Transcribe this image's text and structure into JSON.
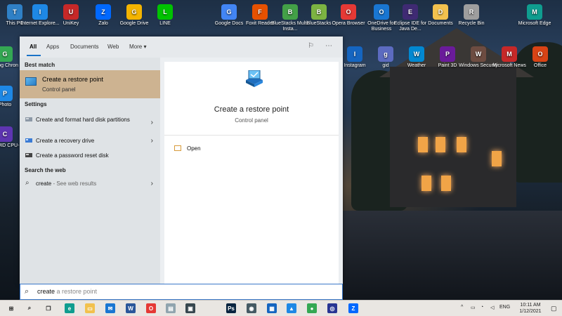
{
  "desktop": {
    "icons_top": [
      {
        "label": "This PC",
        "icon": "this-pc-icon",
        "color": "#2f80c6"
      },
      {
        "label": "Internet Explore...",
        "icon": "internet-explorer-icon",
        "color": "#1e88e5"
      },
      {
        "label": "UniKey",
        "icon": "unikey-icon",
        "color": "#c62828"
      },
      {
        "label": "Zalo",
        "icon": "zalo-icon",
        "color": "#0068ff"
      },
      {
        "label": "Google Drive",
        "icon": "google-drive-icon",
        "color": "#f4b400"
      },
      {
        "label": "LINE",
        "icon": "line-icon",
        "color": "#00c300"
      },
      {
        "label": "Google Docs",
        "icon": "google-docs-icon",
        "color": "#4285f4"
      },
      {
        "label": "Foxit Reader",
        "icon": "foxit-reader-icon",
        "color": "#e65100"
      },
      {
        "label": "BlueStacks Multi-Insta...",
        "icon": "bluestacks-multi-icon",
        "color": "#43a047"
      },
      {
        "label": "BlueStacks",
        "icon": "bluestacks-icon",
        "color": "#7cb342"
      },
      {
        "label": "Opera Browser",
        "icon": "opera-icon",
        "color": "#e53935"
      },
      {
        "label": "OneDrive for Business",
        "icon": "onedrive-icon",
        "color": "#1976d2"
      },
      {
        "label": "Eclipse IDE for Java De...",
        "icon": "eclipse-icon",
        "color": "#3f2a73"
      },
      {
        "label": "Documents",
        "icon": "documents-folder-icon",
        "color": "#f2c14e"
      },
      {
        "label": "Recycle Bin",
        "icon": "recycle-bin-icon",
        "color": "#9e9e9e"
      },
      {
        "label": "Microsoft Edge",
        "icon": "microsoft-edge-icon",
        "color": "#0f9d8f"
      }
    ],
    "icons_row2": [
      {
        "label": "Instagram",
        "icon": "instagram-icon",
        "color": "#1565c0"
      },
      {
        "label": "gid",
        "icon": "clock-app-icon",
        "color": "#5c6bc0"
      },
      {
        "label": "Weather",
        "icon": "weather-icon",
        "color": "#0288d1"
      },
      {
        "label": "Paint 3D",
        "icon": "paint-3d-icon",
        "color": "#6a1b9a"
      },
      {
        "label": "Windows Security",
        "icon": "windows-security-icon",
        "color": "#6d4c41"
      },
      {
        "label": "Microsoft News",
        "icon": "microsoft-news-icon",
        "color": "#c62828"
      },
      {
        "label": "Office",
        "icon": "office-icon",
        "color": "#d84315"
      }
    ],
    "icons_left": [
      {
        "label": "Goog Chron",
        "icon": "chrome-icon",
        "color": "#34a853"
      },
      {
        "label": "Photo",
        "icon": "photos-icon",
        "color": "#1e88e5"
      },
      {
        "label": "CPUID CPU-",
        "icon": "cpuid-icon",
        "color": "#5e35b1"
      }
    ]
  },
  "search": {
    "tabs": [
      "All",
      "Apps",
      "Documents",
      "Web",
      "More ▾"
    ],
    "feedback_icon": "feedback-icon",
    "more_options_icon": "more-options-icon",
    "best_match_heading": "Best match",
    "best_match": {
      "title": "Create a restore point",
      "subtitle": "Control panel"
    },
    "settings_heading": "Settings",
    "settings": [
      {
        "label": "Create and format hard disk partitions"
      },
      {
        "label": "Create a recovery drive"
      },
      {
        "label": "Create a password reset disk"
      }
    ],
    "web_heading": "Search the web",
    "web_result": {
      "query": "create",
      "suffix": " - See web results"
    },
    "preview": {
      "title": "Create a restore point",
      "subtitle": "Control panel",
      "action": "Open"
    },
    "query_typed": "create",
    "query_ghost": " a restore point"
  },
  "taskbar": {
    "apps": [
      {
        "icon": "windows-start-icon",
        "color": "#222222",
        "glyph": "⊞"
      },
      {
        "icon": "search-icon",
        "color": "#222222",
        "glyph": "⌕"
      },
      {
        "icon": "task-view-icon",
        "color": "#222222",
        "glyph": "❐"
      },
      {
        "icon": "edge-taskbar-icon",
        "color": "#0f9d8f",
        "glyph": "e"
      },
      {
        "icon": "file-explorer-icon",
        "color": "#f2c14e",
        "glyph": "▭"
      },
      {
        "icon": "mail-icon",
        "color": "#1976d2",
        "glyph": "✉"
      },
      {
        "icon": "word-icon",
        "color": "#2b579a",
        "glyph": "W"
      },
      {
        "icon": "opera-taskbar-icon",
        "color": "#e53935",
        "glyph": "O"
      },
      {
        "icon": "notepad-icon",
        "color": "#90a4ae",
        "glyph": "▤"
      },
      {
        "icon": "store-icon",
        "color": "#37474f",
        "glyph": "▣"
      },
      {
        "icon": "photoshop-icon",
        "color": "#0a2540",
        "glyph": "Ps"
      },
      {
        "icon": "camera-icon",
        "color": "#455a64",
        "glyph": "◉"
      },
      {
        "icon": "virtualbox-icon",
        "color": "#1565c0",
        "glyph": "▦"
      },
      {
        "icon": "photos-taskbar-icon",
        "color": "#1e88e5",
        "glyph": "▲"
      },
      {
        "icon": "chrome-taskbar-icon",
        "color": "#34a853",
        "glyph": "●"
      },
      {
        "icon": "bluestacks-taskbar-icon",
        "color": "#283593",
        "glyph": "◎"
      },
      {
        "icon": "zalo-taskbar-icon",
        "color": "#0068ff",
        "glyph": "Z"
      }
    ],
    "language": "ENG",
    "time": "10:11 AM",
    "date": "1/12/2021"
  }
}
